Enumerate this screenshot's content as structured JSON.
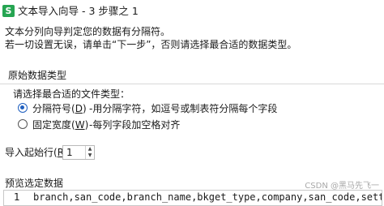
{
  "window": {
    "icon_glyph": "S",
    "icon_name": "wps-spreadsheet-icon",
    "title": "文本导入向导 - 3 步骤之 1"
  },
  "description": {
    "line1": "文本分列向导判定您的数据有分隔符。",
    "line2": "若一切设置无误，请单击“下一步”，否则请选择最合适的数据类型。"
  },
  "original_data_type": {
    "group_label": "原始数据类型",
    "prompt": "请选择最合适的文件类型：",
    "options": [
      {
        "label_before": "分隔符号(",
        "label_key": "D",
        "label_after": ")",
        "description": "-用分隔字符，如逗号或制表符分隔每个字段",
        "checked": true
      },
      {
        "label_before": "固定宽度(",
        "label_key": "W",
        "label_after": ")",
        "description": "-每列字段加空格对齐",
        "checked": false
      }
    ]
  },
  "start_row": {
    "label_before": "导入起始行(",
    "label_key": "R",
    "label_after": "):",
    "value": "1"
  },
  "preview": {
    "label": "预览选定数据",
    "rows": [
      {
        "number": "1",
        "text": "branch,san_code,branch_name,bkget_type,company,san_code,settle_party,p"
      }
    ]
  },
  "watermark": "CSDN @黑马先飞一",
  "colors": {
    "accent": "#1f5fbf",
    "app_icon": "#26a552"
  }
}
